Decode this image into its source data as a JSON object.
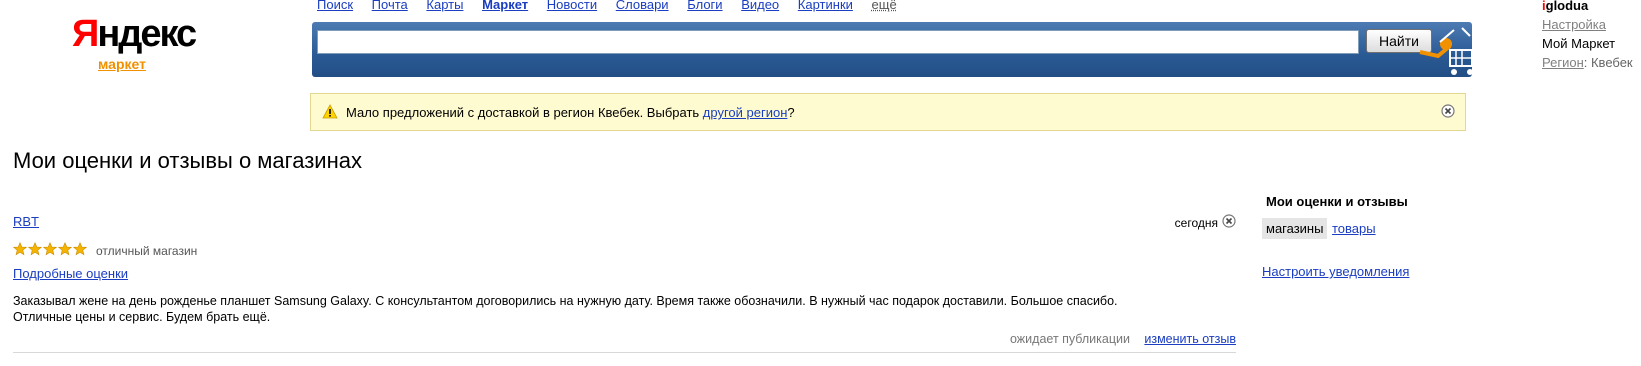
{
  "logo": {
    "brand_first": "Я",
    "brand_rest": "ндекс",
    "sub": "маркет"
  },
  "topnav": {
    "items": [
      "Поиск",
      "Почта",
      "Карты",
      "Маркет",
      "Новости",
      "Словари",
      "Блоги",
      "Видео",
      "Картинки"
    ],
    "more": "ещё"
  },
  "search": {
    "value": "",
    "placeholder": "",
    "button_label": "Найти"
  },
  "user": {
    "name_first": "i",
    "name_rest": "glodua",
    "settings": "Настройка",
    "my_market": "Мой Маркет",
    "region_label": "Регион",
    "region_sep": ":",
    "region_value": " Квебек"
  },
  "notice": {
    "text_before": "Мало предложений с доставкой в регион Квебек. Выбрать ",
    "link": "другой регион",
    "text_after": "?",
    "icon": "warning-icon"
  },
  "page_title": "Мои оценки и отзывы о магазинах",
  "review": {
    "shop": "RBT",
    "date": "сегодня",
    "stars": 5,
    "max_stars": 5,
    "rating_text": "отличный магазин",
    "details_link": "Подробные оценки",
    "text": "Заказывал жене на день рожденье планшет Samsung Galaxy. С консультантом договорились на нужную дату. Время также обозначили. В нужный час подарок доставили. Большое спасибо. Отличные цены и сервис. Будем брать ещё.",
    "status": "ожидает публикации",
    "edit_link": "изменить отзыв"
  },
  "sidebar": {
    "title": "Мои оценки и отзывы",
    "tab_active": "магазины",
    "tab_other": "товары",
    "notify_link": "Настроить уведомления"
  },
  "colors": {
    "link": "#1a3dc1",
    "logo_red": "#ff0000",
    "market_orange": "#f29100",
    "notice_bg": "#fffbd1",
    "searchbar_blue": "#2a5a94",
    "star": "#f5b400"
  }
}
